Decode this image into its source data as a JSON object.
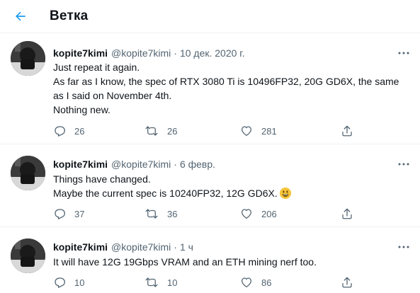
{
  "header": {
    "title": "Ветка"
  },
  "colors": {
    "accent": "#1d9bf0",
    "muted": "#536471",
    "text": "#0f1419"
  },
  "tweets": [
    {
      "name": "kopite7kimi",
      "handle": "@kopite7kimi",
      "time": "10 дек. 2020 г.",
      "lines": [
        "Just repeat it again.",
        "As far as I know, the spec of RTX 3080 Ti is 10496FP32, 20G GD6X, the same",
        "as I said on November 4th.",
        "Nothing new."
      ],
      "replies": "26",
      "retweets": "26",
      "likes": "281"
    },
    {
      "name": "kopite7kimi",
      "handle": "@kopite7kimi",
      "time": "6 февр.",
      "lines": [
        "Things have changed.",
        "Maybe the current spec is 10240FP32, 12G GD6X."
      ],
      "emoji": "grinning-face-emoji",
      "replies": "37",
      "retweets": "36",
      "likes": "206"
    },
    {
      "name": "kopite7kimi",
      "handle": "@kopite7kimi",
      "time": "1 ч",
      "lines": [
        "It will have 12G 19Gbps VRAM and an ETH mining nerf too."
      ],
      "replies": "10",
      "retweets": "10",
      "likes": "86"
    }
  ]
}
